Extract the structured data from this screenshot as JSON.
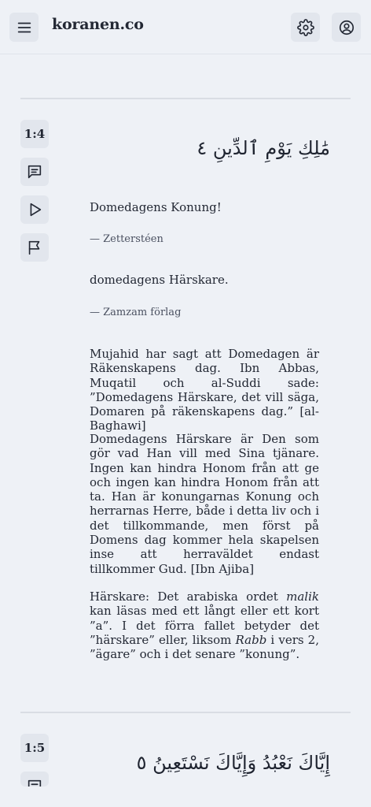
{
  "header": {
    "site_title": "koranen.co",
    "menu_icon": "hamburger-menu-icon",
    "settings_icon": "gear-icon",
    "account_icon": "user-circle-icon"
  },
  "verses": [
    {
      "number": "1:4",
      "arabic": "مَٰلِكِ يَوْمِ ٱلدِّينِ ٤",
      "translations": [
        {
          "text": "Domedagens Konung!",
          "source": "— Zetterstéen"
        },
        {
          "text": "domedagens Härskare.",
          "source": "— Zamzam förlag"
        }
      ],
      "commentary": {
        "p1": "Mujahid har sagt att Domedagen är Räkenskapens dag. Ibn Abbas, Muqatil och al-Suddi sade: ”Domedagens Härskare, det vill säga, Domaren på räkenskapens dag.” [al-Baghawi]",
        "p2": "Domedagens Härskare är Den som gör vad Han vill med Sina tjänare. Ingen kan hindra Honom från att ge och ingen kan hindra Honom från att ta. Han är konungarnas Konung och herrarnas Herre, både i detta liv och i det tillkommande, men först på Domens dag kommer hela skapelsen inse att herraväldet endast tillkommer Gud. [Ibn Ajiba]",
        "p3_term": "Härskare",
        "p3_a": ": Det arabiska ordet ",
        "p3_word1": "malik",
        "p3_b": " kan läsas med ett långt eller ett kort ”a”. I det förra fallet betyder det ”härskare” eller, liksom ",
        "p3_word2": "Rabb",
        "p3_c": " i vers 2, ”ägare” och i det senare ”konung”."
      }
    },
    {
      "number": "1:5",
      "arabic": "إِيَّاكَ نَعْبُدُ وَإِيَّاكَ نَسْتَعِينُ ٥"
    }
  ],
  "verse_actions": {
    "comment_icon": "comment-icon",
    "play_icon": "play-icon",
    "flag_icon": "flag-icon"
  }
}
